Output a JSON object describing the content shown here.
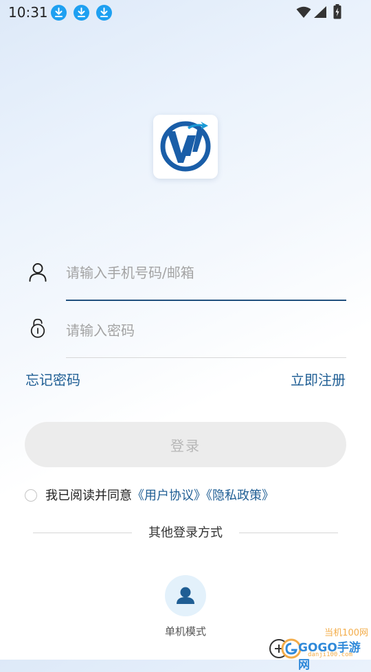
{
  "status_bar": {
    "time": "10:31",
    "notification_icons": [
      "download-icon",
      "download-icon",
      "download-icon"
    ],
    "right_icons": [
      "wifi-icon",
      "cellular-signal-icon",
      "battery-charging-icon"
    ]
  },
  "logo": {
    "icon": "app-logo-icon"
  },
  "form": {
    "username": {
      "icon": "user-icon",
      "placeholder": "请输入手机号码/邮箱",
      "value": ""
    },
    "password": {
      "icon": "lock-icon",
      "placeholder": "请输入密码",
      "value": ""
    },
    "forgot_password": "忘记密码",
    "register_now": "立即注册",
    "login_button": "登录"
  },
  "agreement": {
    "checked": false,
    "prefix": "我已阅读并同意",
    "user_agreement": "《用户协议》",
    "privacy_policy": "《隐私政策》"
  },
  "other_login": {
    "title": "其他登录方式",
    "modes": [
      {
        "icon": "person-icon",
        "label": "单机模式"
      }
    ]
  },
  "watermark": {
    "top": "当机100网",
    "middle": "GOGO手游网",
    "bottom": "danji100.com"
  },
  "colors": {
    "accent": "#1f5e94",
    "active_underline": "#1f4f7d",
    "download_badge": "#1ea0f1",
    "login_button_bg": "#ececec",
    "login_button_text": "#b7b7b7",
    "mode_circle_bg": "#e3f1fb",
    "mode_icon": "#1f5e94"
  }
}
